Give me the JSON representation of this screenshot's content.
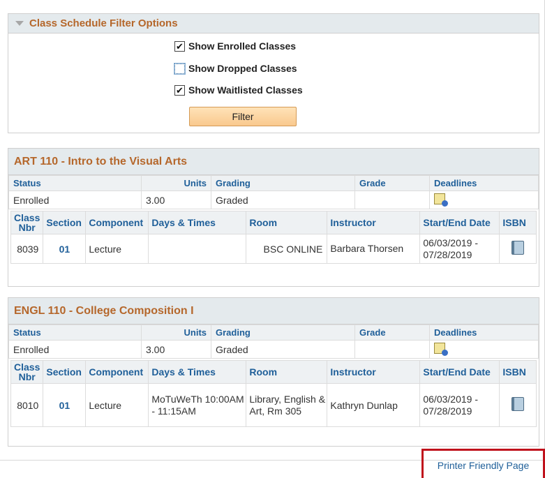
{
  "filter": {
    "title": "Class Schedule Filter Options",
    "options": [
      {
        "label": "Show Enrolled Classes",
        "checked": "✔"
      },
      {
        "label": "Show Dropped Classes",
        "checked": ""
      },
      {
        "label": "Show Waitlisted Classes",
        "checked": "✔"
      }
    ],
    "button_label": "Filter"
  },
  "summary_headers": [
    "Status",
    "Units",
    "Grading",
    "Grade",
    "Deadlines"
  ],
  "detail_headers": [
    "Class Nbr",
    "Section",
    "Component",
    "Days & Times",
    "Room",
    "Instructor",
    "Start/End Date",
    "ISBN"
  ],
  "classes": [
    {
      "title": "ART 110 - Intro to the Visual Arts",
      "status": "Enrolled",
      "units": "3.00",
      "grading": "Graded",
      "grade": "",
      "class_nbr": "8039",
      "section": "01",
      "component": "Lecture",
      "days_times": "",
      "room": "BSC ONLINE",
      "instructor": "Barbara Thorsen",
      "start_end": "06/03/2019 - 07/28/2019"
    },
    {
      "title": "ENGL 110 - College Composition I",
      "status": "Enrolled",
      "units": "3.00",
      "grading": "Graded",
      "grade": "",
      "class_nbr": "8010",
      "section": "01",
      "component": "Lecture",
      "days_times": "MoTuWeTh 10:00AM - 11:15AM",
      "room": "Library, English & Art, Rm 305",
      "instructor": "Kathryn Dunlap",
      "start_end": "06/03/2019 - 07/28/2019"
    }
  ],
  "footer": {
    "printer_link": "Printer Friendly Page"
  },
  "icons": {
    "deadlines": "calendar-info-icon",
    "isbn": "book-icon",
    "collapse": "triangle-down-icon"
  },
  "colors": {
    "section_title": "#b5672b",
    "link": "#1f5f99",
    "header_bg": "#e4eaed",
    "button": "#f9c98e",
    "highlight_border": "#c0121c"
  }
}
